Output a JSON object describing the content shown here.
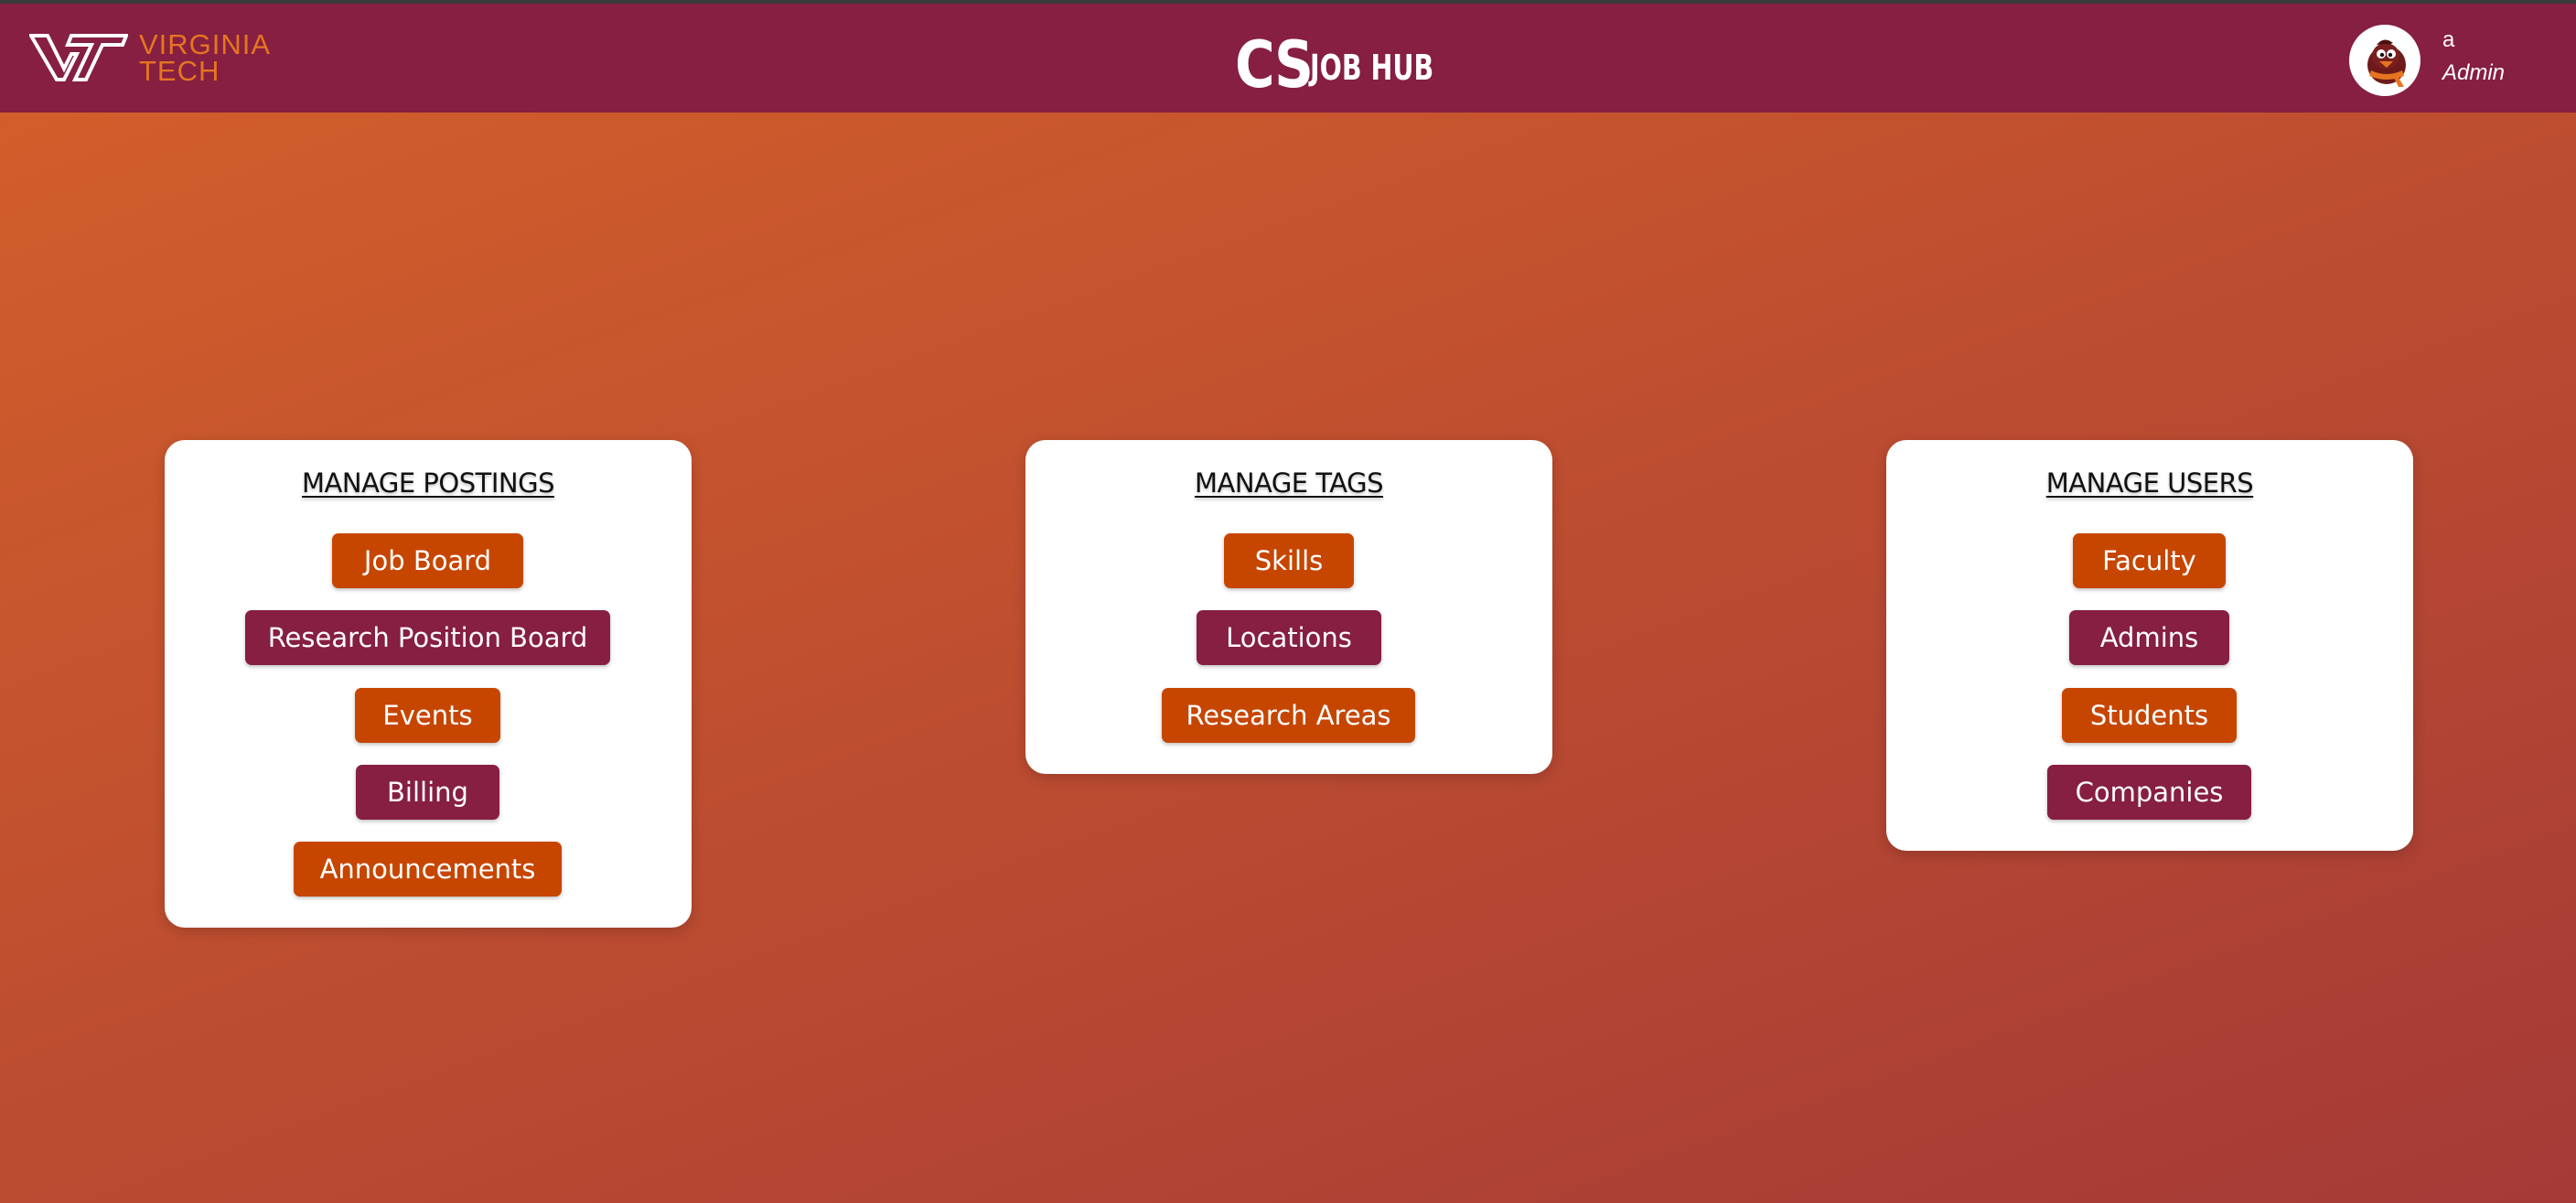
{
  "header": {
    "logo_line1": "VIRGINIA",
    "logo_line2": "TECH",
    "brand_cs": "CS",
    "brand_rest": "JOB HUB",
    "user_name": "a",
    "user_role": "Admin"
  },
  "colors": {
    "header_bg": "#861f41",
    "logo_orange": "#e5751f",
    "button_orange": "#c64600",
    "button_maroon": "#861f41",
    "background_start": "#d4602a",
    "background_end": "#a53a37"
  },
  "icons": {
    "logo": "vt-logo-icon",
    "avatar": "hokiebird-avatar-icon"
  },
  "cards": {
    "postings": {
      "title": "MANAGE POSTINGS",
      "buttons": [
        "Job Board",
        "Research Position Board",
        "Events",
        "Billing",
        "Announcements"
      ]
    },
    "tags": {
      "title": "MANAGE TAGS",
      "buttons": [
        "Skills",
        "Locations",
        "Research Areas"
      ]
    },
    "users": {
      "title": "MANAGE USERS",
      "buttons": [
        "Faculty",
        "Admins",
        "Students",
        "Companies"
      ]
    }
  }
}
